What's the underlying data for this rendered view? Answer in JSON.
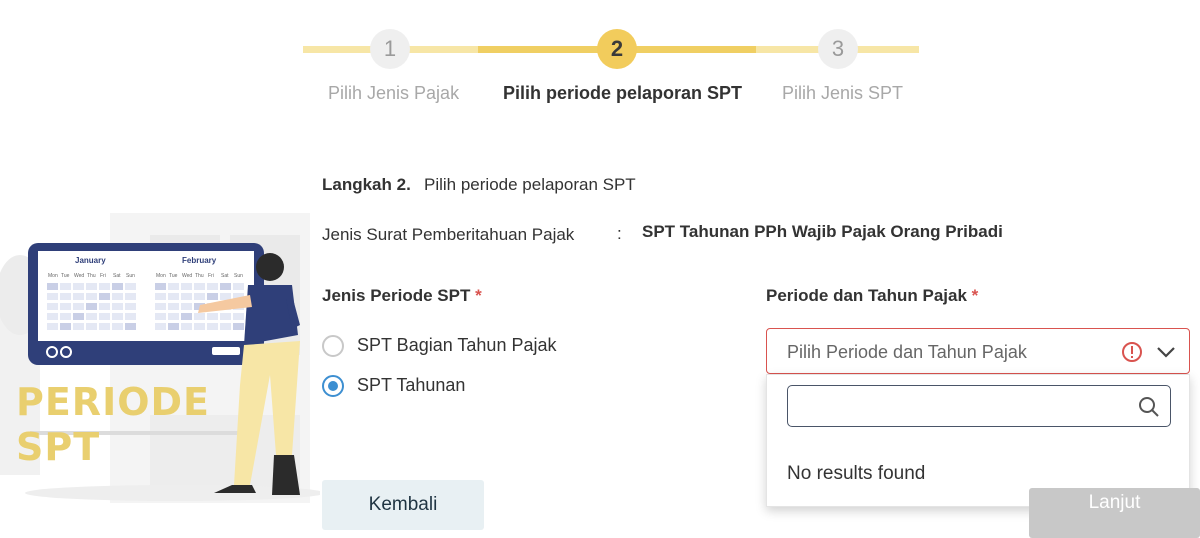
{
  "stepper": {
    "steps": [
      {
        "number": "1",
        "label": "Pilih Jenis Pajak"
      },
      {
        "number": "2",
        "label": "Pilih periode pelaporan SPT"
      },
      {
        "number": "3",
        "label": "Pilih Jenis SPT"
      }
    ],
    "active_step": 2
  },
  "illustration": {
    "line1": "PERIODE",
    "line2": "SPT",
    "calendar": {
      "month1": "January",
      "month2": "February",
      "weekdays": [
        "Mon",
        "Tue",
        "Wed",
        "Thu",
        "Fri",
        "Sat",
        "Sun"
      ]
    }
  },
  "form": {
    "step_title": "Langkah 2.",
    "step_desc": "Pilih periode pelaporan SPT",
    "jenis_label": "Jenis Surat Pemberitahuan Pajak",
    "separator": ":",
    "jenis_value": "SPT Tahunan PPh Wajib Pajak Orang Pribadi",
    "periode_jenis_label": "Jenis Periode SPT",
    "required_mark": "*",
    "radio_options": [
      {
        "label": "SPT Bagian Tahun Pajak",
        "selected": false
      },
      {
        "label": "SPT Tahunan",
        "selected": true
      }
    ],
    "periode_tahun_label": "Periode dan Tahun Pajak",
    "select_placeholder": "Pilih Periode dan Tahun Pajak",
    "search_value": "",
    "no_results": "No results found"
  },
  "buttons": {
    "back": "Kembali",
    "next": "Lanjut"
  },
  "colors": {
    "accent": "#f2cc5c",
    "error": "#d9534f",
    "radio": "#3d8fd1"
  }
}
